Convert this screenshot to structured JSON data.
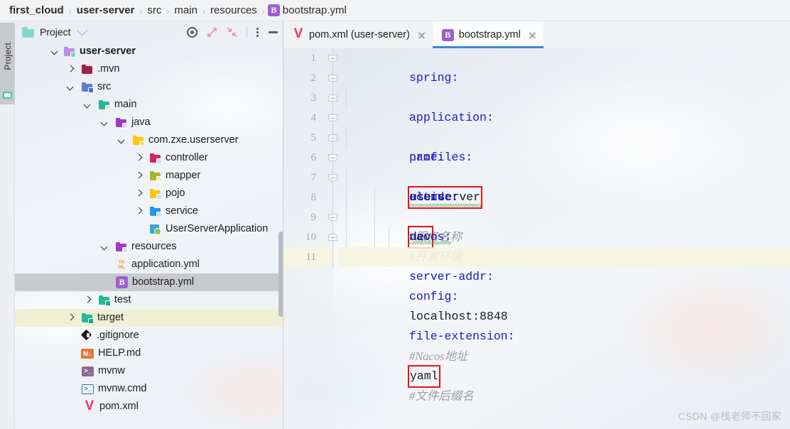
{
  "breadcrumb": {
    "items": [
      {
        "label": "first_cloud",
        "bold": true,
        "icon": null
      },
      {
        "label": "user-server",
        "bold": true,
        "icon": null
      },
      {
        "label": "src",
        "bold": false,
        "icon": null
      },
      {
        "label": "main",
        "bold": false,
        "icon": null
      },
      {
        "label": "resources",
        "bold": false,
        "icon": null
      },
      {
        "label": "bootstrap.yml",
        "bold": false,
        "icon": "bootstrap-yml-icon"
      }
    ],
    "separator": "›"
  },
  "tool_strip": {
    "project_tab_label": "Project",
    "project_tab_icon": "monitor-icon"
  },
  "project_panel": {
    "toolbar": {
      "title": "Project",
      "dropdown_icon": "chevron-down-icon",
      "locate_icon": "target-icon",
      "expand_icon": "expand-all-icon",
      "collapse_icon": "collapse-all-icon",
      "more_icon": "more-vertical-icon",
      "minimize_icon": "minimize-icon"
    },
    "tree": [
      {
        "label": "user-server",
        "depth": 1,
        "twisty": "down",
        "icon": "module-folder-icon",
        "bold": true,
        "state": "none"
      },
      {
        "label": ".mvn",
        "depth": 2,
        "twisty": "right",
        "icon": "folder-darkred-icon",
        "bold": false,
        "state": "none"
      },
      {
        "label": "src",
        "depth": 2,
        "twisty": "down",
        "icon": "folder-source-icon",
        "bold": false,
        "state": "none"
      },
      {
        "label": "main",
        "depth": 3,
        "twisty": "down",
        "icon": "folder-teal-icon",
        "bold": false,
        "state": "none"
      },
      {
        "label": "java",
        "depth": 4,
        "twisty": "down",
        "icon": "folder-java-icon",
        "bold": false,
        "state": "none"
      },
      {
        "label": "com.zxe.userserver",
        "depth": 5,
        "twisty": "down",
        "icon": "folder-package-icon",
        "bold": false,
        "state": "none"
      },
      {
        "label": "controller",
        "depth": 6,
        "twisty": "right",
        "icon": "folder-pink-icon",
        "bold": false,
        "state": "none"
      },
      {
        "label": "mapper",
        "depth": 6,
        "twisty": "right",
        "icon": "folder-olive-icon",
        "bold": false,
        "state": "none"
      },
      {
        "label": "pojo",
        "depth": 6,
        "twisty": "right",
        "icon": "folder-yellow-icon",
        "bold": false,
        "state": "none"
      },
      {
        "label": "service",
        "depth": 6,
        "twisty": "right",
        "icon": "folder-blue-icon",
        "bold": false,
        "state": "none"
      },
      {
        "label": "UserServerApplication",
        "depth": 6,
        "twisty": "none",
        "icon": "java-class-icon",
        "bold": false,
        "state": "none"
      },
      {
        "label": "resources",
        "depth": 4,
        "twisty": "down",
        "icon": "folder-resources-icon",
        "bold": false,
        "state": "none"
      },
      {
        "label": "application.yml",
        "depth": 5,
        "twisty": "none",
        "icon": "yaml-file-icon",
        "bold": false,
        "state": "none"
      },
      {
        "label": "bootstrap.yml",
        "depth": 5,
        "twisty": "none",
        "icon": "bootstrap-yml-icon",
        "bold": false,
        "state": "selected"
      },
      {
        "label": "test",
        "depth": 3,
        "twisty": "right",
        "icon": "folder-test-icon",
        "bold": false,
        "state": "none"
      },
      {
        "label": "target",
        "depth": 2,
        "twisty": "right",
        "icon": "folder-target-icon",
        "bold": false,
        "state": "highlighted"
      },
      {
        "label": ".gitignore",
        "depth": 3,
        "twisty": "none",
        "icon": "git-icon",
        "bold": false,
        "state": "none"
      },
      {
        "label": "HELP.md",
        "depth": 3,
        "twisty": "none",
        "icon": "markdown-icon",
        "bold": false,
        "state": "none"
      },
      {
        "label": "mvnw",
        "depth": 3,
        "twisty": "none",
        "icon": "shell-script-icon",
        "bold": false,
        "state": "none"
      },
      {
        "label": "mvnw.cmd",
        "depth": 3,
        "twisty": "none",
        "icon": "cmd-script-icon",
        "bold": false,
        "state": "none"
      },
      {
        "label": "pom.xml",
        "depth": 3,
        "twisty": "none",
        "icon": "maven-icon",
        "bold": false,
        "state": "none"
      }
    ]
  },
  "editor": {
    "tabs": [
      {
        "label": "pom.xml (user-server)",
        "icon": "maven-icon",
        "active": false,
        "close_icon": "close-icon"
      },
      {
        "label": "bootstrap.yml",
        "icon": "bootstrap-yml-icon",
        "active": true,
        "close_icon": "close-icon"
      }
    ],
    "current_line": 11,
    "line_numbers": [
      1,
      2,
      3,
      4,
      5,
      6,
      7,
      8,
      9,
      10,
      11
    ],
    "lines": [
      {
        "n": 1,
        "indent": 0,
        "key": "spring:",
        "value": "",
        "comment": "",
        "boxed": false,
        "squiggly": false,
        "fold": "down"
      },
      {
        "n": 2,
        "indent": 2,
        "key": "application:",
        "value": "",
        "comment": "",
        "boxed": false,
        "squiggly": false,
        "fold": "down"
      },
      {
        "n": 3,
        "indent": 4,
        "key": "name:",
        "value": "userserver",
        "comment": "#服务名称",
        "boxed": true,
        "squiggly": true,
        "fold": "up"
      },
      {
        "n": 4,
        "indent": 2,
        "key": "profiles:",
        "value": "",
        "comment": "",
        "boxed": false,
        "squiggly": false,
        "fold": "down"
      },
      {
        "n": 5,
        "indent": 4,
        "key": "active:",
        "value": "dev",
        "comment": "#开发环境",
        "boxed": true,
        "squiggly": false,
        "fold": "up"
      },
      {
        "n": 6,
        "indent": 2,
        "key": "cloud:",
        "value": "",
        "comment": "",
        "boxed": false,
        "squiggly": false,
        "fold": "down"
      },
      {
        "n": 7,
        "indent": 4,
        "key": "nacos:",
        "value": "",
        "comment": "",
        "boxed": false,
        "squiggly": true,
        "fold": "down"
      },
      {
        "n": 8,
        "indent": 6,
        "key": "server-addr:",
        "value": "localhost:8848",
        "comment": "#Nacos地址",
        "boxed": false,
        "squiggly": false,
        "fold": "none"
      },
      {
        "n": 9,
        "indent": 6,
        "key": "config:",
        "value": "",
        "comment": "",
        "boxed": false,
        "squiggly": false,
        "fold": "down"
      },
      {
        "n": 10,
        "indent": 8,
        "key": "file-extension:",
        "value": "yaml",
        "comment": "#文件后缀名",
        "boxed": true,
        "squiggly": false,
        "fold": "up"
      },
      {
        "n": 11,
        "indent": 0,
        "key": "",
        "value": "",
        "comment": "",
        "boxed": false,
        "squiggly": false,
        "fold": "none"
      }
    ]
  },
  "watermark": {
    "text": "CSDN @栈老师不回家"
  },
  "colors": {
    "yaml_key": "#1a1ac9",
    "yaml_value": "#1a1a1a",
    "comment": "#9aa0a6",
    "annotation_box": "#ef1212",
    "active_tab_underline": "#3e86d6",
    "selection": "#c9cacc",
    "highlight": "#eff0d3"
  }
}
